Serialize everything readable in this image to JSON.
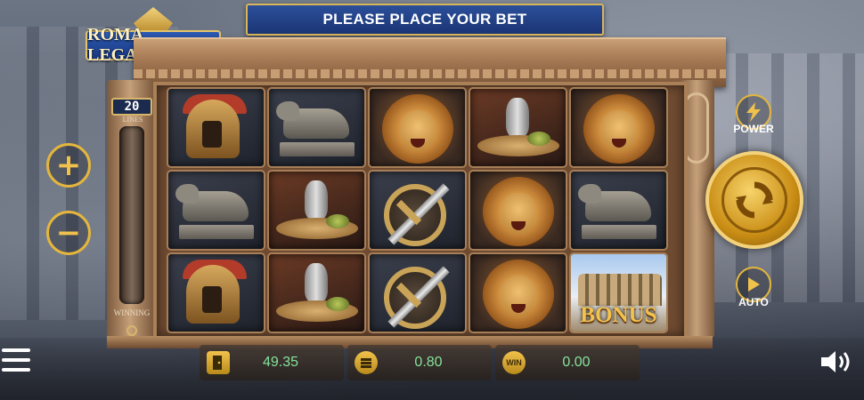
{
  "header": {
    "banner_text": "PLEASE PLACE YOUR BET",
    "logo_text": "ROMA LEGACY"
  },
  "lines_meter": {
    "lines_value": "20",
    "lines_label": "LINES",
    "winning_label": "WINNING"
  },
  "reels": [
    [
      "gladiator",
      "she-wolf",
      "lion",
      "feast",
      "lion"
    ],
    [
      "she-wolf",
      "feast",
      "shield-sword",
      "lion",
      "she-wolf"
    ],
    [
      "gladiator",
      "feast",
      "shield-sword",
      "lion",
      "bonus"
    ]
  ],
  "bonus_symbol_text": "BONUS",
  "controls": {
    "plus_label": "+",
    "minus_label": "−",
    "power_label": "POWER",
    "auto_label": "AUTO"
  },
  "stats": {
    "balance": "49.35",
    "bet": "0.80",
    "win": "0.00",
    "win_icon_text": "WIN"
  },
  "colors": {
    "accent_gold": "#e4b63d",
    "value_green": "#86e39a",
    "banner_blue": "#1b3574"
  },
  "icons": {
    "menu": "hamburger-menu-icon",
    "sound": "speaker-icon",
    "power": "lightning-icon",
    "auto": "play-icon",
    "spin": "refresh-arrows-icon",
    "balance": "exit-door-icon",
    "bet": "coin-stack-icon",
    "win": "win-badge-icon"
  }
}
